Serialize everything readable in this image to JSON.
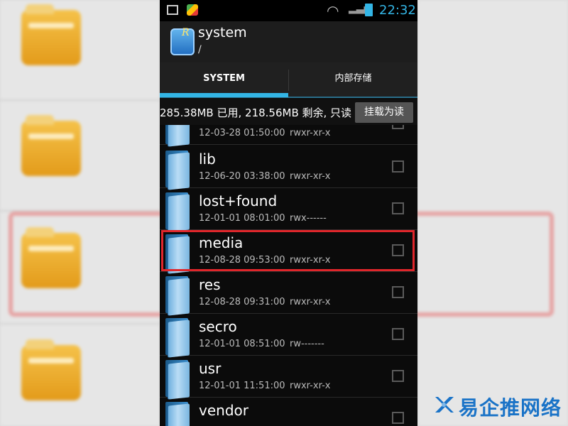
{
  "status_bar": {
    "time": "22:32"
  },
  "app_bar": {
    "title": "system",
    "path": "/"
  },
  "tabs": [
    {
      "label": "SYSTEM",
      "selected": true
    },
    {
      "label": "内部存储",
      "selected": false
    }
  ],
  "storage": {
    "info": "285.38MB 已用, 218.56MB 剩余, 只读",
    "mount_button": "挂载为读"
  },
  "files": [
    {
      "name": "",
      "date": "12-03-28 01:50:00",
      "perm": "rwxr-xr-x"
    },
    {
      "name": "lib",
      "date": "12-06-20 03:38:00",
      "perm": "rwxr-xr-x"
    },
    {
      "name": "lost+found",
      "date": "12-01-01 08:01:00",
      "perm": "rwx------"
    },
    {
      "name": "media",
      "date": "12-08-28 09:53:00",
      "perm": "rwxr-xr-x",
      "highlighted": true
    },
    {
      "name": "res",
      "date": "12-08-28 09:31:00",
      "perm": "rwxr-xr-x"
    },
    {
      "name": "secro",
      "date": "12-01-01 08:51:00",
      "perm": "rw-------"
    },
    {
      "name": "usr",
      "date": "12-01-01 11:51:00",
      "perm": "rwxr-xr-x"
    },
    {
      "name": "vendor",
      "date": "",
      "perm": ""
    }
  ],
  "watermark": {
    "text": "易企推网络"
  }
}
